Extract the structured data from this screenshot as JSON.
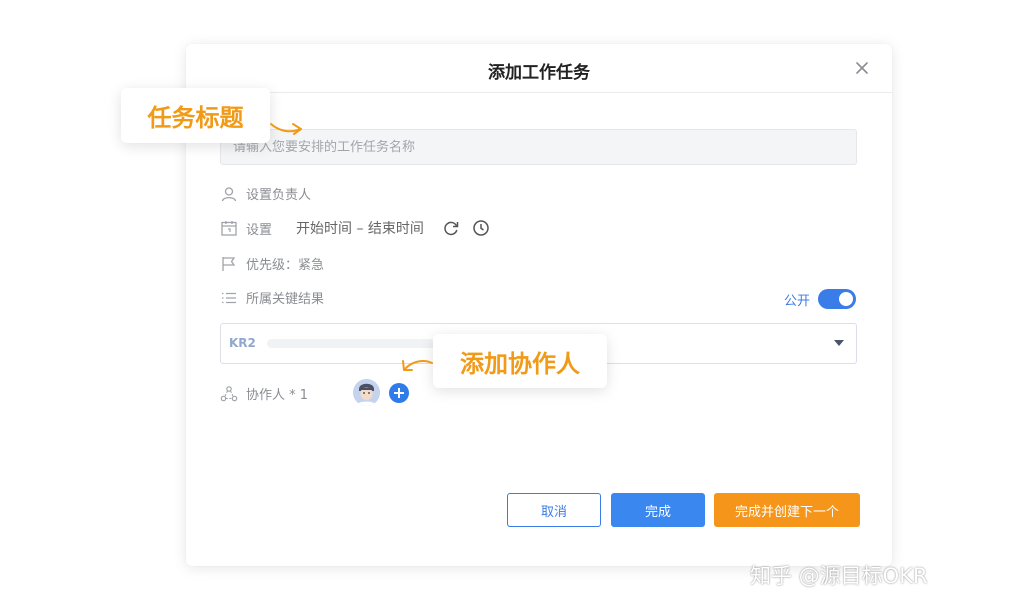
{
  "dialog": {
    "title": "添加工作任务",
    "title_input": {
      "placeholder": "请输入您要安排的工作任务名称",
      "value": ""
    },
    "assignee_label": "设置负责人",
    "schedule": {
      "label": "设置",
      "range": "开始时间 – 结束时间",
      "icons": [
        "repeat-icon",
        "clock-icon"
      ]
    },
    "priority_label": "优先级：紧急",
    "key_result": {
      "label": "所属关键结果",
      "public_label": "公开",
      "public_on": true,
      "selected_tag": "KR2"
    },
    "collaborator": {
      "label": "协作人 * 1",
      "count": 1
    },
    "buttons": {
      "cancel": "取消",
      "done": "完成",
      "done_and_next": "完成并创建下一个"
    }
  },
  "callouts": {
    "task_title": "任务标题",
    "add_collaborator": "添加协作人"
  },
  "watermark": "知乎 @源目标OKR",
  "colors": {
    "primary": "#3a87f0",
    "accent_orange": "#f5951a",
    "callout_text": "#f19a18"
  }
}
